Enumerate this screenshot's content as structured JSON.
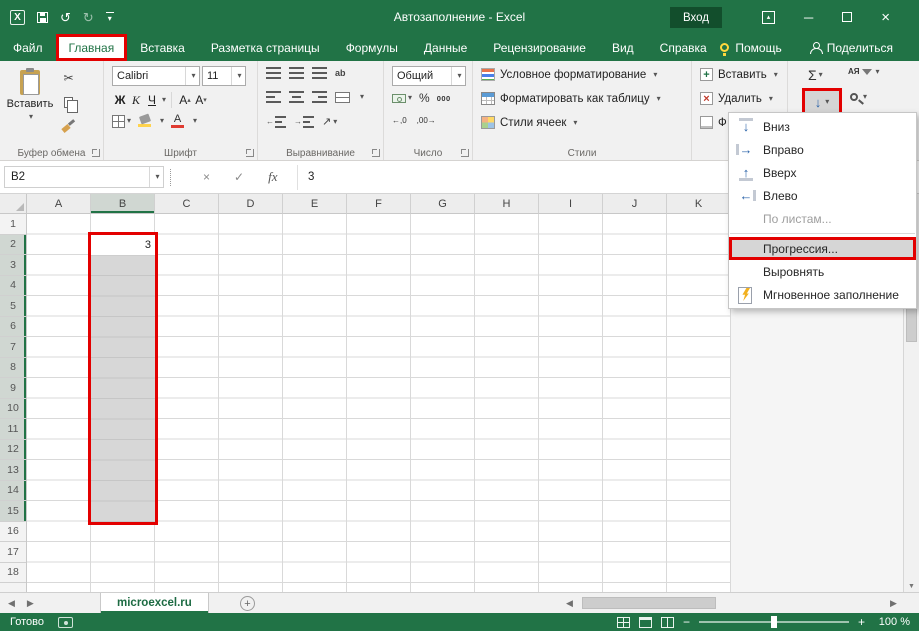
{
  "icons": {
    "caret": "▾",
    "tri_up": "▴",
    "undo": "↺",
    "redo": "↻",
    "close": "×",
    "minimize": "─",
    "cut": "✂",
    "check": "✓",
    "cancel": "×",
    "left_nav": "◀",
    "right_nav": "▶",
    "up_small": "▲",
    "down_small": "▼",
    "diag_arrow": "↗",
    "arrow_left": "←",
    "arrow_right": "→",
    "plus": "+",
    "minus": "−",
    "blue_down": "↓"
  },
  "titlebar": {
    "logo_letter": "X",
    "title": "Автозаполнение - Excel",
    "sign_in": "Вход"
  },
  "ribbon_tabs": {
    "file": "Файл",
    "home": "Главная",
    "others": [
      {
        "label": "Вставка",
        "name": "insert"
      },
      {
        "label": "Разметка страницы",
        "name": "page-layout"
      },
      {
        "label": "Формулы",
        "name": "formulas"
      },
      {
        "label": "Данные",
        "name": "data"
      },
      {
        "label": "Рецензирование",
        "name": "review"
      },
      {
        "label": "Вид",
        "name": "view"
      },
      {
        "label": "Справка",
        "name": "help"
      }
    ],
    "help": "Помощь",
    "share": "Поделиться"
  },
  "ribbon": {
    "clipboard": {
      "paste": "Вставить",
      "group_label": "Буфер обмена"
    },
    "font": {
      "family": "Calibri",
      "size": "11",
      "bold": "Ж",
      "italic": "К",
      "underline": "Ч",
      "grow_letter": "А",
      "shrink_letter": "А",
      "color_letter": "А",
      "group_label": "Шрифт"
    },
    "alignment": {
      "wrap_text": "ab",
      "group_label": "Выравнивание"
    },
    "number": {
      "format": "Общий",
      "percent": "%",
      "thousands": "000",
      "decrease_decimal": "←,0",
      "increase_decimal": ",00→",
      "group_label": "Число"
    },
    "styles": {
      "conditional": "Условное форматирование",
      "format_table": "Форматировать как таблицу",
      "cell_styles": "Стили ячеек",
      "group_label": "Стили"
    },
    "cells": {
      "insert": "Вставить",
      "delete": "Удалить",
      "format_partial": "Ф"
    },
    "editing": {
      "autosum": "Σ",
      "sort_letters": "АЯ"
    }
  },
  "formula_bar": {
    "name_box": "B2",
    "fx": "fx",
    "value": "3"
  },
  "grid": {
    "columns": [
      "A",
      "B",
      "C",
      "D",
      "E",
      "F",
      "G",
      "H",
      "I",
      "J",
      "K"
    ],
    "rows": [
      "1",
      "2",
      "3",
      "4",
      "5",
      "6",
      "7",
      "8",
      "9",
      "10",
      "11",
      "12",
      "13",
      "14",
      "15",
      "16",
      "17",
      "18"
    ],
    "selected_column": "B",
    "selected_rows_from": 2,
    "selected_rows_to": 15,
    "active_cell": "B2",
    "active_cell_value": "3"
  },
  "fill_menu": {
    "items": [
      {
        "label": "Вниз",
        "name": "fill-down",
        "icon": "fill-down-icon",
        "glyph": "↓",
        "disabled": false,
        "highlighted": false,
        "separator_after": false
      },
      {
        "label": "Вправо",
        "name": "fill-right",
        "icon": "fill-right-icon",
        "glyph": "→",
        "disabled": false,
        "highlighted": false,
        "separator_after": false
      },
      {
        "label": "Вверх",
        "name": "fill-up",
        "icon": "fill-up-icon",
        "glyph": "↑",
        "disabled": false,
        "highlighted": false,
        "separator_after": false
      },
      {
        "label": "Влево",
        "name": "fill-left",
        "icon": "fill-left-icon",
        "glyph": "←",
        "disabled": false,
        "highlighted": false,
        "separator_after": false
      },
      {
        "label": "По листам...",
        "name": "across-sheets",
        "icon": "",
        "glyph": "",
        "disabled": true,
        "highlighted": false,
        "separator_after": true
      },
      {
        "label": "Прогрессия...",
        "name": "series",
        "icon": "",
        "glyph": "",
        "disabled": false,
        "highlighted": true,
        "separator_after": false
      },
      {
        "label": "Выровнять",
        "name": "justify",
        "icon": "",
        "glyph": "",
        "disabled": false,
        "highlighted": false,
        "separator_after": false
      },
      {
        "label": "Мгновенное заполнение",
        "name": "flash-fill",
        "icon": "flash-fill-icon",
        "glyph": "",
        "disabled": false,
        "highlighted": false,
        "separator_after": false
      }
    ]
  },
  "sheet_tabs": {
    "active_tab": "microexcel.ru"
  },
  "status_bar": {
    "mode": "Готово",
    "zoom": "100 %"
  }
}
